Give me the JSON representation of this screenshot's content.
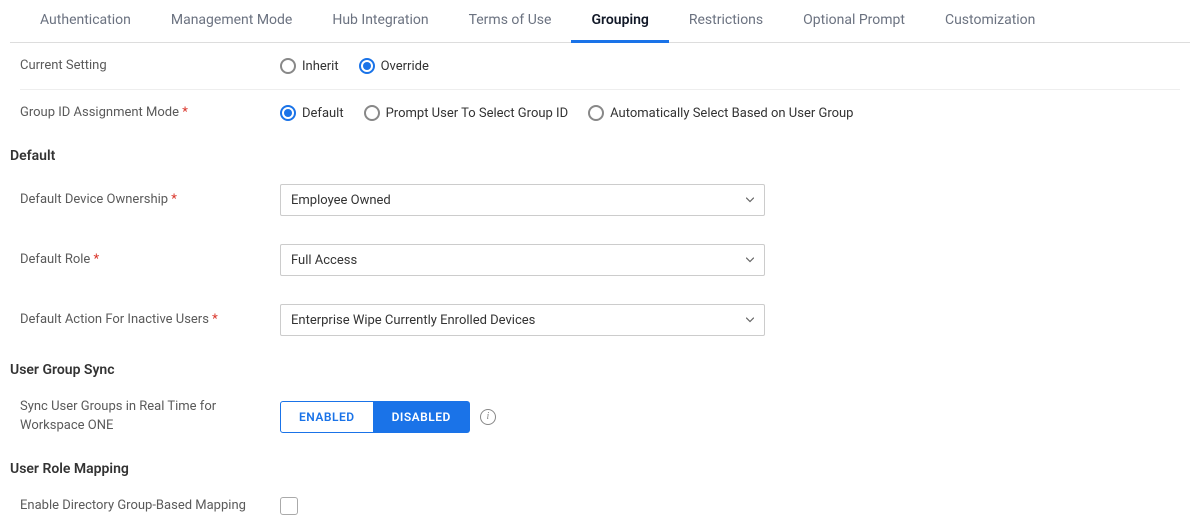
{
  "tabs": [
    {
      "label": "Authentication",
      "active": false
    },
    {
      "label": "Management Mode",
      "active": false
    },
    {
      "label": "Hub Integration",
      "active": false
    },
    {
      "label": "Terms of Use",
      "active": false
    },
    {
      "label": "Grouping",
      "active": true
    },
    {
      "label": "Restrictions",
      "active": false
    },
    {
      "label": "Optional Prompt",
      "active": false
    },
    {
      "label": "Customization",
      "active": false
    }
  ],
  "currentSetting": {
    "label": "Current Setting",
    "options": [
      "Inherit",
      "Override"
    ],
    "selected": "Override"
  },
  "groupIdMode": {
    "label": "Group ID Assignment Mode",
    "required": true,
    "options": [
      "Default",
      "Prompt User To Select Group ID",
      "Automatically Select Based on User Group"
    ],
    "selected": "Default"
  },
  "sections": {
    "default": {
      "heading": "Default",
      "deviceOwnership": {
        "label": "Default Device Ownership",
        "required": true,
        "value": "Employee Owned"
      },
      "role": {
        "label": "Default Role",
        "required": true,
        "value": "Full Access"
      },
      "inactiveAction": {
        "label": "Default Action For Inactive Users",
        "required": true,
        "value": "Enterprise Wipe Currently Enrolled Devices"
      }
    },
    "userGroupSync": {
      "heading": "User Group Sync",
      "syncRealTime": {
        "label": "Sync User Groups in Real Time for Workspace ONE",
        "enabledLabel": "ENABLED",
        "disabledLabel": "DISABLED",
        "value": "DISABLED"
      }
    },
    "userRoleMapping": {
      "heading": "User Role Mapping",
      "enableDirectory": {
        "label": "Enable Directory Group-Based Mapping",
        "checked": false
      }
    }
  }
}
